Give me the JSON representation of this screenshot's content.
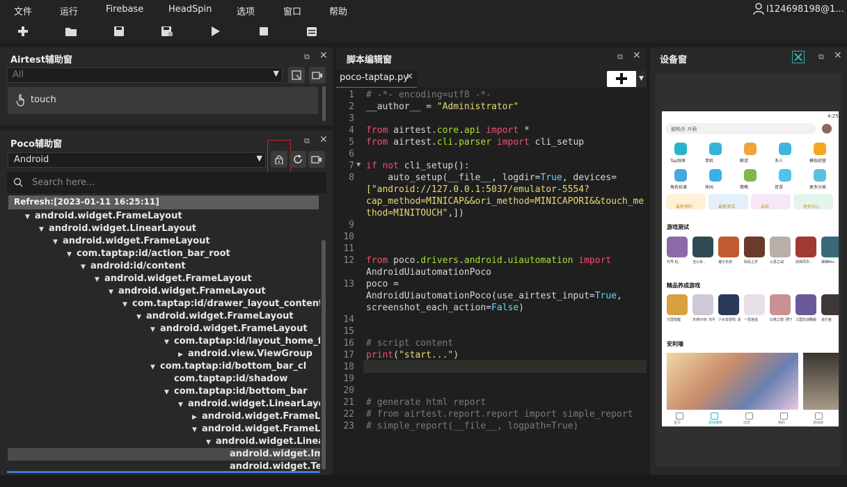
{
  "menu": {
    "items": [
      "文件",
      "运行",
      "Firebase",
      "HeadSpin",
      "选项",
      "窗口",
      "帮助"
    ],
    "user": "l124698198@1..."
  },
  "airtest": {
    "title": "Airtest辅助窗",
    "filter": "All",
    "item": "touch"
  },
  "poco": {
    "title": "Poco辅助窗",
    "mode": "Android",
    "search_placeholder": "Search here...",
    "refresh": "Refresh:[2023-01-11 16:25:11]",
    "tree": [
      {
        "label": "android.widget.FrameLayout",
        "depth": 0,
        "arrow": "down"
      },
      {
        "label": "android.widget.LinearLayout",
        "depth": 1,
        "arrow": "down"
      },
      {
        "label": "android.widget.FrameLayout",
        "depth": 2,
        "arrow": "down"
      },
      {
        "label": "com.taptap:id/action_bar_root",
        "depth": 3,
        "arrow": "down"
      },
      {
        "label": "android:id/content",
        "depth": 4,
        "arrow": "down"
      },
      {
        "label": "android.widget.FrameLayout",
        "depth": 5,
        "arrow": "down"
      },
      {
        "label": "android.widget.FrameLayout",
        "depth": 6,
        "arrow": "down"
      },
      {
        "label": "com.taptap:id/drawer_layout_content",
        "depth": 7,
        "arrow": "down"
      },
      {
        "label": "android.widget.FrameLayout",
        "depth": 8,
        "arrow": "down"
      },
      {
        "label": "android.widget.FrameLayout",
        "depth": 9,
        "arrow": "down"
      },
      {
        "label": "com.taptap:id/layout_home_fragm",
        "depth": 10,
        "arrow": "down"
      },
      {
        "label": "android.view.ViewGroup",
        "depth": 11,
        "arrow": "right"
      },
      {
        "label": "com.taptap:id/bottom_bar_cl",
        "depth": 9,
        "arrow": "down"
      },
      {
        "label": "com.taptap:id/shadow",
        "depth": 10,
        "arrow": "none"
      },
      {
        "label": "com.taptap:id/bottom_bar",
        "depth": 10,
        "arrow": "down"
      },
      {
        "label": "android.widget.LinearLayout",
        "depth": 11,
        "arrow": "down"
      },
      {
        "label": "android.widget.FrameLayou",
        "depth": 12,
        "arrow": "right"
      },
      {
        "label": "android.widget.FrameLayou",
        "depth": 12,
        "arrow": "down"
      },
      {
        "label": "android.widget.LinearLa",
        "depth": 13,
        "arrow": "down"
      },
      {
        "label": "android.widget.Imag",
        "depth": 14,
        "arrow": "none",
        "selected": true
      },
      {
        "label": "android.widget.TextV",
        "depth": 14,
        "arrow": "none"
      }
    ]
  },
  "editor": {
    "title": "脚本编辑窗",
    "tab": "poco-taptap.py",
    "line_numbers": [
      "1",
      "2",
      "3",
      "4",
      "5",
      "6",
      "7",
      "8",
      "9",
      "10",
      "11",
      "12",
      "13",
      "14",
      "15",
      "16",
      "17",
      "18",
      "19",
      "20",
      "21",
      "22",
      "23"
    ]
  },
  "device": {
    "title": "设备窗",
    "status_time": "4:25",
    "search_text": "鹅鸭杀 卉萌",
    "icons": [
      "Tap独享",
      "单机",
      "解谜",
      "多人",
      "模拟经营",
      "角色扮演",
      "休闲",
      "策略",
      "音游",
      "更多分类"
    ],
    "chips": [
      "最新预约",
      "最新测试",
      "云玩",
      "抢先中心"
    ],
    "sec1": "游戏测试",
    "games1": [
      "代号:虹..",
      "当火车...",
      "诸子无双",
      "妈妈上字",
      "火恶之战",
      "剑侠风华..",
      "弹弹Rec.."
    ],
    "sec2": "精品养成游戏",
    "games2": [
      "万国觉醒",
      "天使计划: 无尽...",
      "少女去冒险: 超远...",
      "一念逍遥",
      "幻塔之罪 (预下载)",
      "三国志战略版",
      "远行者"
    ],
    "sec3": "安利墙",
    "tabs": [
      "首页",
      "游戏推荐",
      "动态",
      "我的",
      "游戏库"
    ]
  }
}
